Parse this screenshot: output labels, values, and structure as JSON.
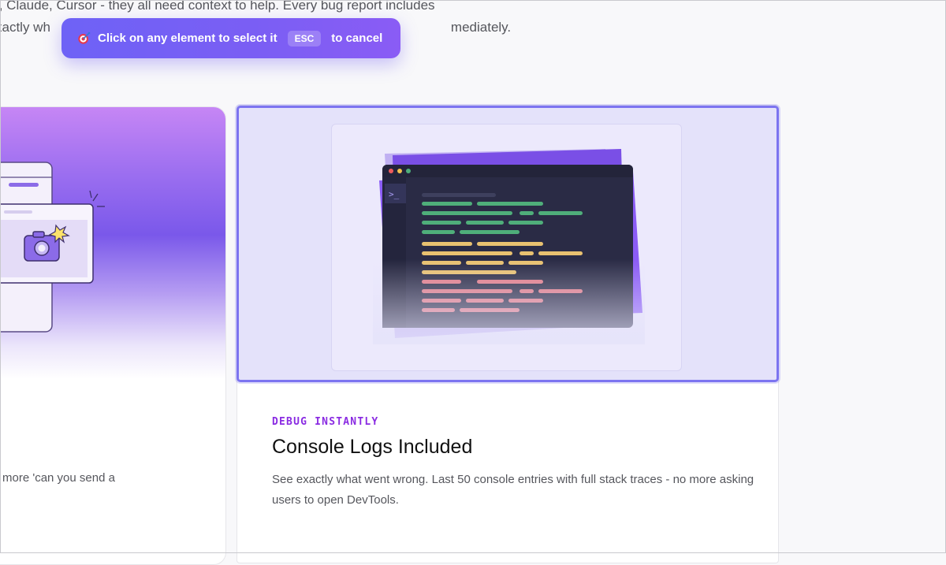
{
  "intro": {
    "line1": "t, Claude, Cursor - they all need context to help. Every bug report includes",
    "line2_start": "xactly wh",
    "line2_end": "mediately."
  },
  "toast": {
    "message": "Click on any element to select it",
    "key": "ESC",
    "suffix": "to cancel",
    "icon": "target-icon"
  },
  "left_card": {
    "description": "more 'can you send a",
    "illustration_icon": "camera-icon"
  },
  "right_card": {
    "eyebrow": "DEBUG INSTANTLY",
    "title": "Console Logs Included",
    "body": "See exactly what went wrong. Last 50 console entries with full stack traces - no more asking users to open DevTools.",
    "prompt_glyph": ">_"
  },
  "colors": {
    "accent": "#7b5ef4",
    "highlight_border": "#7c74f0",
    "eyebrow": "#8a2be2",
    "log_green": "#4fae7a",
    "log_yellow": "#e8c170",
    "log_red": "#e07a86"
  }
}
